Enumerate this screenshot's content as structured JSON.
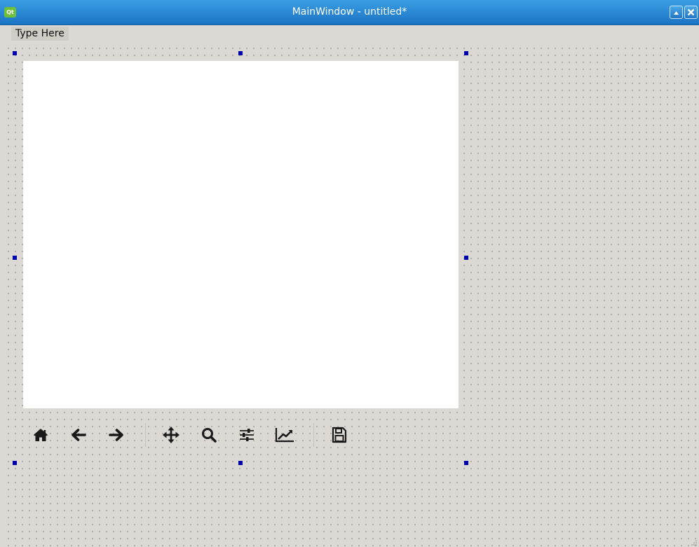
{
  "window": {
    "title": "MainWindow - untitled*",
    "app_icon": "qt-designer-icon",
    "controls": [
      "maximize-icon",
      "close-icon"
    ]
  },
  "menubar": {
    "items": [
      {
        "label": "Type Here"
      }
    ]
  },
  "plot": {
    "background": "#ffffff"
  },
  "toolbar": {
    "buttons": [
      {
        "name": "home",
        "icon": "home-icon"
      },
      {
        "name": "back",
        "icon": "arrow-left-icon"
      },
      {
        "name": "forward",
        "icon": "arrow-right-icon"
      },
      {
        "name": "pan",
        "icon": "move-icon"
      },
      {
        "name": "zoom",
        "icon": "magnifier-icon"
      },
      {
        "name": "subplots",
        "icon": "sliders-icon"
      },
      {
        "name": "customize",
        "icon": "line-chart-icon"
      },
      {
        "name": "save",
        "icon": "floppy-icon"
      }
    ]
  },
  "colors": {
    "titlebar": "#1c73c4",
    "canvas": "#dcd9d4",
    "selection_handle": "#0000a8"
  }
}
